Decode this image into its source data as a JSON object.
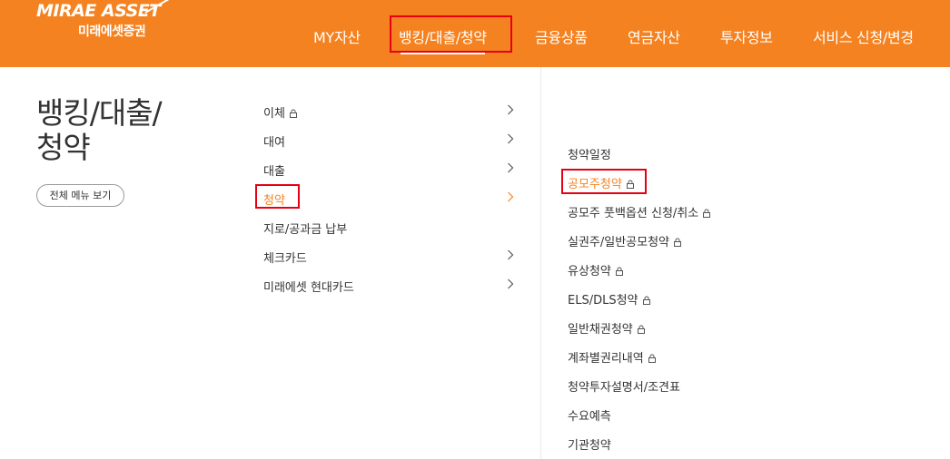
{
  "logo": {
    "name": "MIRAE ASSET",
    "korean": "미래에셋증권"
  },
  "gnb": {
    "items": [
      {
        "label": "MY자산"
      },
      {
        "label": "뱅킹/대출/청약"
      },
      {
        "label": "금융상품"
      },
      {
        "label": "연금자산"
      },
      {
        "label": "투자정보"
      },
      {
        "label": "서비스 신청/변경"
      }
    ],
    "active_index": 1
  },
  "section": {
    "title_line1": "뱅킹/대출/",
    "title_line2": "청약",
    "all_menu_label": "전체 메뉴 보기"
  },
  "submenu": {
    "items": [
      {
        "label": "이체",
        "locked": true,
        "has_children": true
      },
      {
        "label": "대여",
        "locked": false,
        "has_children": true
      },
      {
        "label": "대출",
        "locked": false,
        "has_children": true
      },
      {
        "label": "청약",
        "locked": false,
        "has_children": true,
        "active": true
      },
      {
        "label": "지로/공과금 납부",
        "locked": false,
        "has_children": false
      },
      {
        "label": "체크카드",
        "locked": false,
        "has_children": true
      },
      {
        "label": "미래에셋 현대카드",
        "locked": false,
        "has_children": true
      }
    ]
  },
  "subsubmenu": {
    "items": [
      {
        "label": "청약일정",
        "locked": false
      },
      {
        "label": "공모주청약",
        "locked": true,
        "active": true
      },
      {
        "label": "공모주 풋백옵션 신청/취소",
        "locked": true
      },
      {
        "label": "실권주/일반공모청약",
        "locked": true
      },
      {
        "label": "유상청약",
        "locked": true
      },
      {
        "label": "ELS/DLS청약",
        "locked": true
      },
      {
        "label": "일반채권청약",
        "locked": true
      },
      {
        "label": "계좌별권리내역",
        "locked": true
      },
      {
        "label": "청약투자설명서/조견표",
        "locked": false
      },
      {
        "label": "수요예측",
        "locked": false
      },
      {
        "label": "기관청약",
        "locked": false
      }
    ]
  },
  "colors": {
    "brand_orange": "#f58220",
    "highlight_box": "#e60012",
    "text": "#333333"
  }
}
